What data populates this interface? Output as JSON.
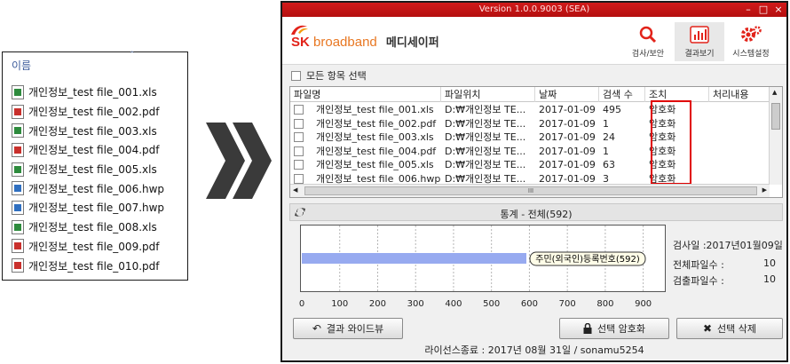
{
  "explorer": {
    "header": "이름",
    "files": [
      {
        "name": "개인정보_test file_001.xls",
        "type": "xls"
      },
      {
        "name": "개인정보_test file_002.pdf",
        "type": "pdf"
      },
      {
        "name": "개인정보_test file_003.xls",
        "type": "xls"
      },
      {
        "name": "개인정보_test file_004.pdf",
        "type": "pdf"
      },
      {
        "name": "개인정보_test file_005.xls",
        "type": "xls"
      },
      {
        "name": "개인정보_test file_006.hwp",
        "type": "hwp"
      },
      {
        "name": "개인정보_test file_007.hwp",
        "type": "hwp"
      },
      {
        "name": "개인정보_test file_008.xls",
        "type": "xls"
      },
      {
        "name": "개인정보_test file_009.pdf",
        "type": "pdf"
      },
      {
        "name": "개인정보_test file_010.pdf",
        "type": "pdf"
      }
    ]
  },
  "app": {
    "version": "Version 1.0.0.9003 (SEA)",
    "logo_sk": "SK",
    "logo_broadband": "broadband",
    "service_name": "메디세이퍼",
    "tools": {
      "search": "검사/보안",
      "results": "결과보기",
      "settings": "시스템설정"
    },
    "select_all": "모든 항목 선택",
    "columns": [
      "파일명",
      "파일위치",
      "날짜",
      "검색 수",
      "조치",
      "처리내용"
    ],
    "rows": [
      {
        "name": "개인정보_test file_001.xls",
        "path": "D:₩개인정보 TE...",
        "date": "2017-01-09",
        "count": "495",
        "action": "암호화",
        "detail": ""
      },
      {
        "name": "개인정보_test file_002.pdf",
        "path": "D:₩개인정보 TE...",
        "date": "2017-01-09",
        "count": "1",
        "action": "암호화",
        "detail": ""
      },
      {
        "name": "개인정보_test file_003.xls",
        "path": "D:₩개인정보 TE...",
        "date": "2017-01-09",
        "count": "24",
        "action": "암호화",
        "detail": ""
      },
      {
        "name": "개인정보_test file_004.pdf",
        "path": "D:₩개인정보 TE...",
        "date": "2017-01-09",
        "count": "1",
        "action": "암호화",
        "detail": ""
      },
      {
        "name": "개인정보_test file_005.xls",
        "path": "D:₩개인정보 TE...",
        "date": "2017-01-09",
        "count": "63",
        "action": "암호화",
        "detail": ""
      },
      {
        "name": "개인정보_test file_006.hwp",
        "path": "D:₩개인정보 TE...",
        "date": "2017-01-09",
        "count": "3",
        "action": "암호화",
        "detail": ""
      }
    ],
    "hscroll_grip": "III",
    "stats_title": "통계 - 전체(592)",
    "stats_info": {
      "scan_date": "검사일 :2017년01월09일",
      "total_label": "전체파일수 :",
      "total_value": "10",
      "detected_label": "검출파일수 :",
      "detected_value": "10"
    },
    "buttons": {
      "wide_view": "결과 와이드뷰",
      "encrypt": "선택 암호화",
      "delete": "선택 삭제"
    },
    "license": "라이선스종료 : 2017년 08월 31일 / sonamu5254"
  },
  "chart_data": {
    "type": "bar",
    "orientation": "horizontal",
    "categories": [
      "주민(외국인)등록번호"
    ],
    "values": [
      592
    ],
    "data_labels": [
      "주민(외국인)등록번호(592)"
    ],
    "xlim": [
      0,
      950
    ],
    "xticks": [
      0,
      100,
      200,
      300,
      400,
      500,
      600,
      700,
      800,
      900
    ],
    "grid": "vertical dashed",
    "bar_color": "#97aaf0"
  },
  "colors": {
    "brand_red": "#e2231a",
    "brand_orange": "#e87722",
    "highlight": "#e00000"
  }
}
